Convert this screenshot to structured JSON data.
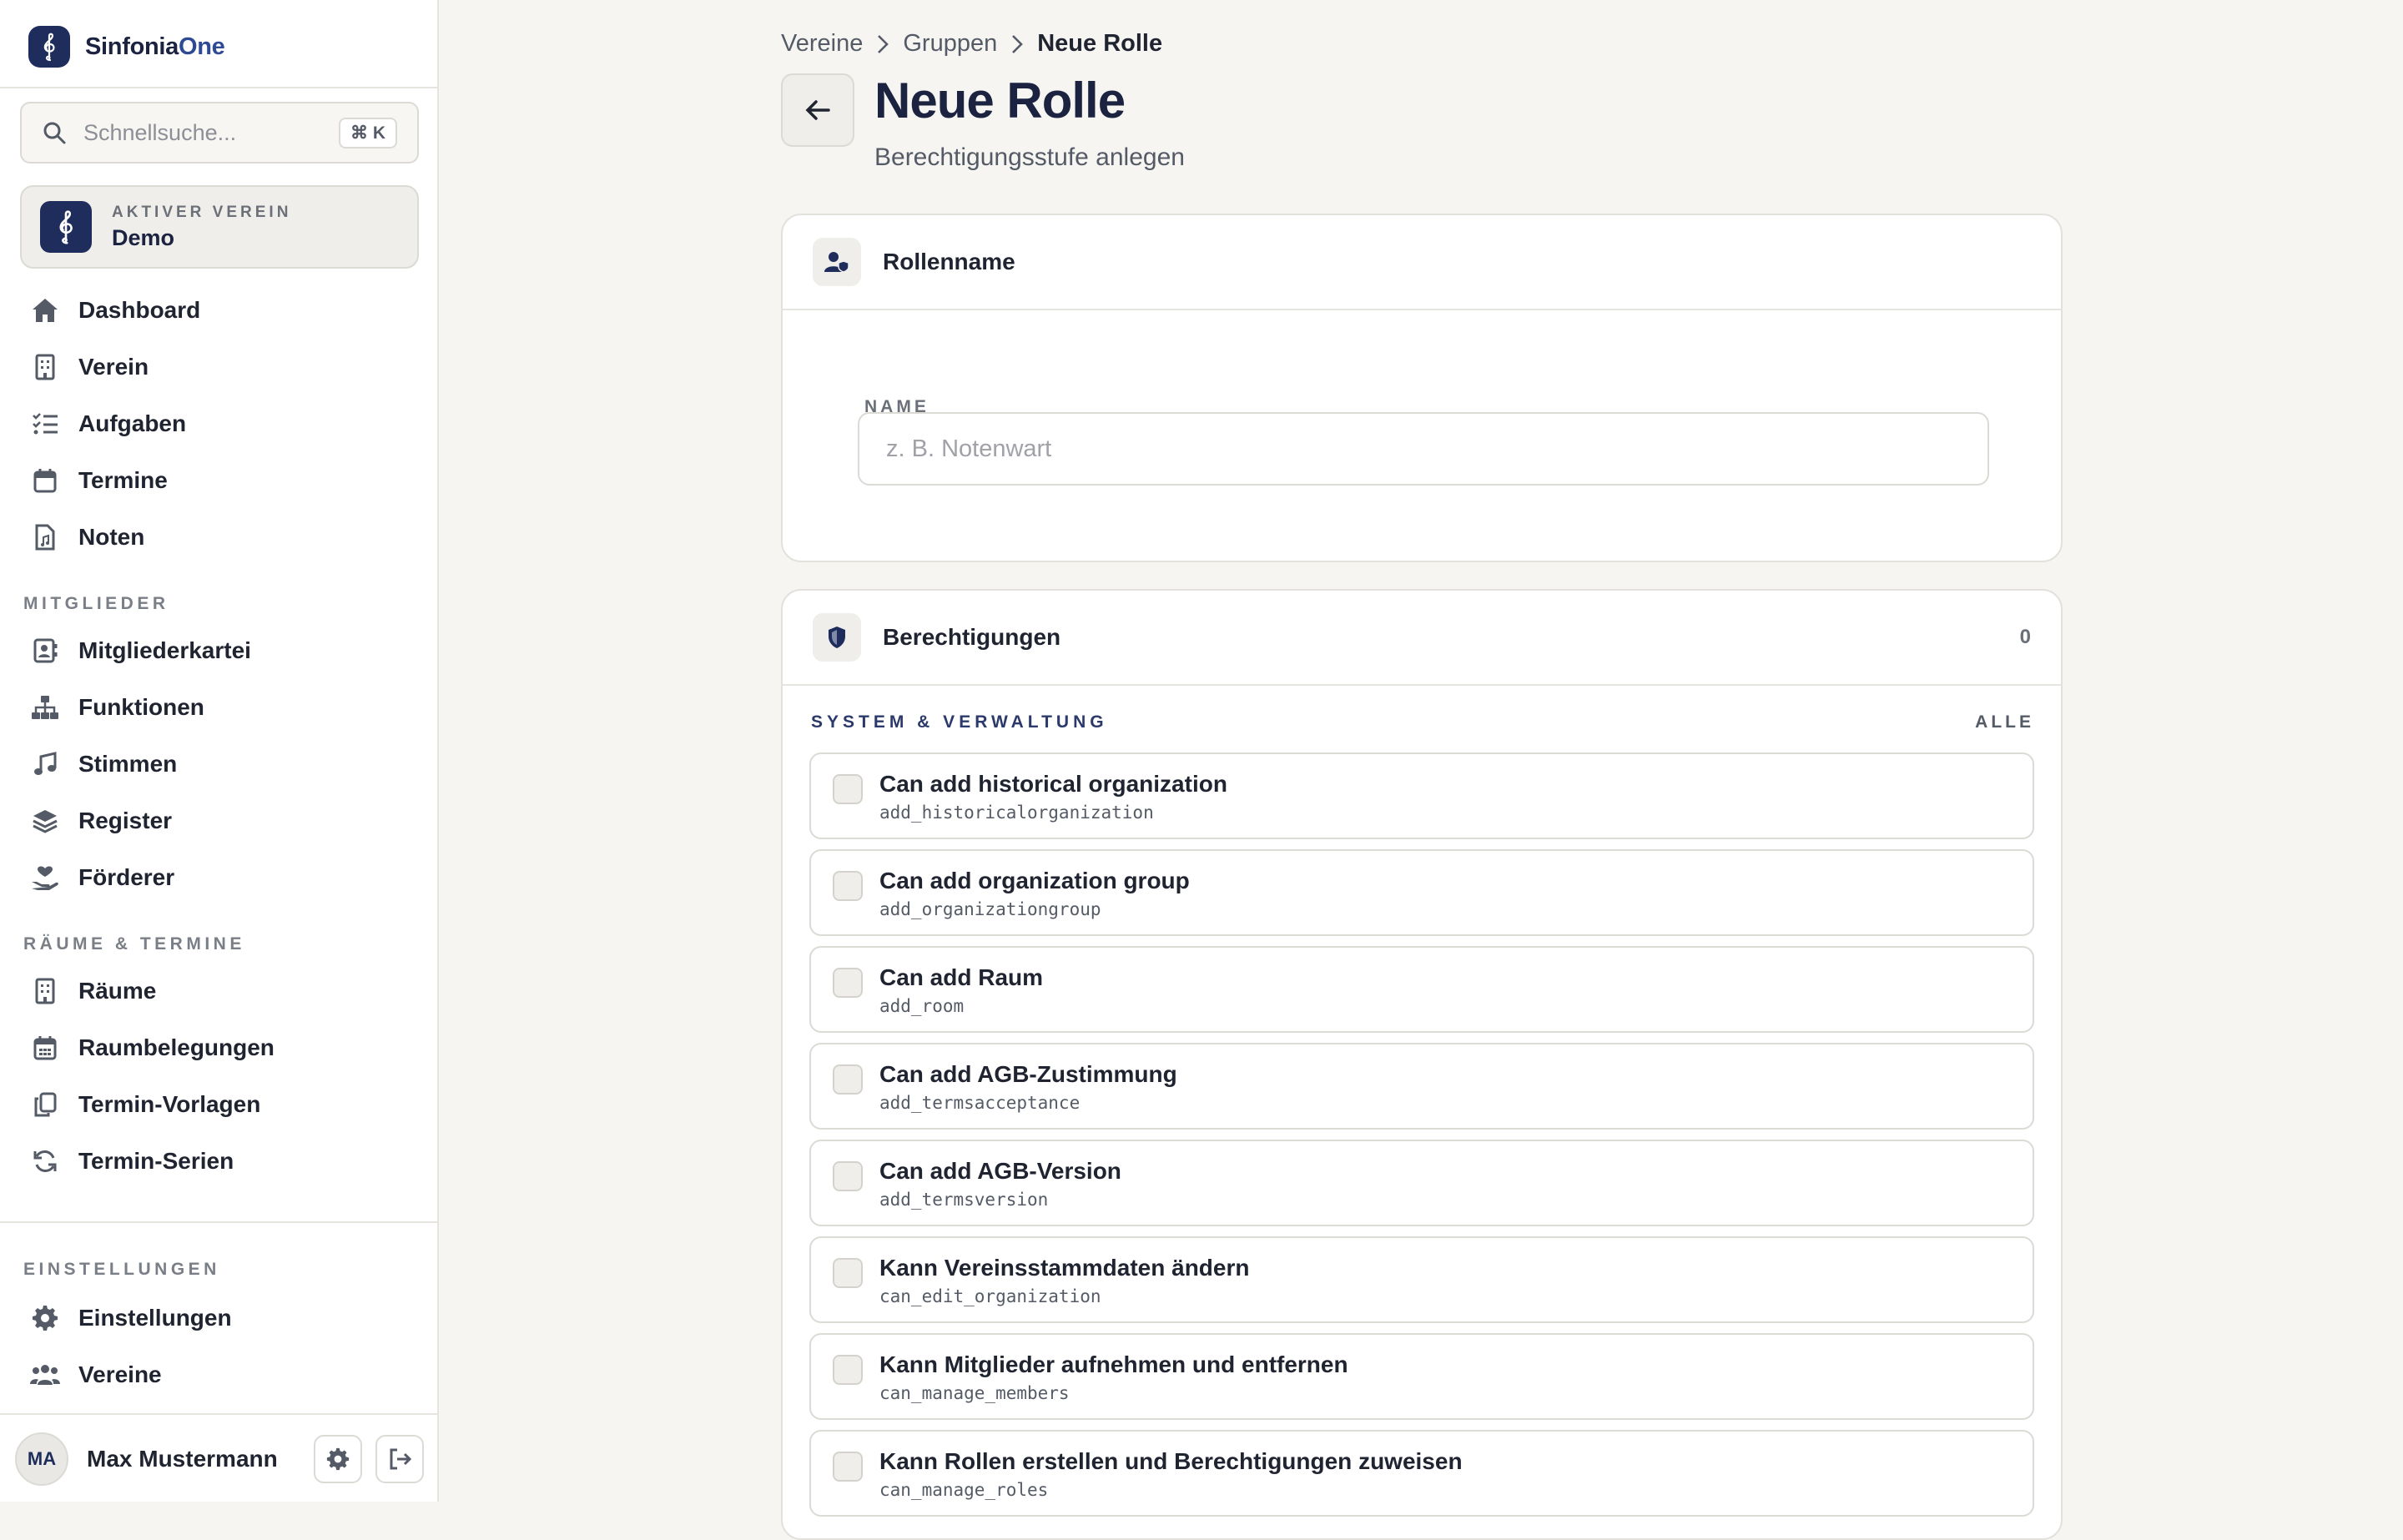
{
  "brand": {
    "name_main": "Sinfonia",
    "name_accent": "One"
  },
  "search": {
    "placeholder": "Schnellsuche...",
    "shortcut": "⌘ K"
  },
  "active_org": {
    "label": "AKTIVER VEREIN",
    "name": "Demo"
  },
  "nav": {
    "main": [
      {
        "label": "Dashboard",
        "icon": "home-icon"
      },
      {
        "label": "Verein",
        "icon": "building-icon"
      },
      {
        "label": "Aufgaben",
        "icon": "list-check-icon"
      },
      {
        "label": "Termine",
        "icon": "calendar-icon"
      },
      {
        "label": "Noten",
        "icon": "file-music-icon"
      }
    ],
    "members_label": "MITGLIEDER",
    "members": [
      {
        "label": "Mitgliederkartei",
        "icon": "contact-card-icon"
      },
      {
        "label": "Funktionen",
        "icon": "sitemap-icon"
      },
      {
        "label": "Stimmen",
        "icon": "music-note-icon"
      },
      {
        "label": "Register",
        "icon": "layers-icon"
      },
      {
        "label": "Förderer",
        "icon": "hand-heart-icon"
      }
    ],
    "rooms_label": "RÄUME & TERMINE",
    "rooms": [
      {
        "label": "Räume",
        "icon": "building-icon"
      },
      {
        "label": "Raumbelegungen",
        "icon": "calendar-grid-icon"
      },
      {
        "label": "Termin-Vorlagen",
        "icon": "copy-icon"
      },
      {
        "label": "Termin-Serien",
        "icon": "refresh-icon"
      }
    ],
    "settings_label": "EINSTELLUNGEN",
    "settings": [
      {
        "label": "Einstellungen",
        "icon": "gear-icon"
      },
      {
        "label": "Vereine",
        "icon": "users-icon"
      }
    ]
  },
  "user": {
    "initials": "MA",
    "name": "Max Mustermann"
  },
  "breadcrumb": [
    "Vereine",
    "Gruppen",
    "Neue Rolle"
  ],
  "page": {
    "title": "Neue Rolle",
    "subtitle": "Berechtigungsstufe anlegen"
  },
  "role_card": {
    "title": "Rollenname",
    "field_label": "NAME",
    "placeholder": "z. B. Notenwart",
    "value": ""
  },
  "perm_card": {
    "title": "Berechtigungen",
    "count": "0",
    "group_title": "SYSTEM & VERWALTUNG",
    "select_all": "ALLE",
    "items": [
      {
        "title": "Can add historical organization",
        "code": "add_historicalorganization",
        "checked": false
      },
      {
        "title": "Can add organization group",
        "code": "add_organizationgroup",
        "checked": false
      },
      {
        "title": "Can add Raum",
        "code": "add_room",
        "checked": false
      },
      {
        "title": "Can add AGB-Zustimmung",
        "code": "add_termsacceptance",
        "checked": false
      },
      {
        "title": "Can add AGB-Version",
        "code": "add_termsversion",
        "checked": false
      },
      {
        "title": "Kann Vereinsstammdaten ändern",
        "code": "can_edit_organization",
        "checked": false
      },
      {
        "title": "Kann Mitglieder aufnehmen und entfernen",
        "code": "can_manage_members",
        "checked": false
      },
      {
        "title": "Kann Rollen erstellen und Berechtigungen zuweisen",
        "code": "can_manage_roles",
        "checked": false
      }
    ]
  },
  "colors": {
    "brand_navy": "#1f2d5c",
    "accent_blue": "#2e4a94",
    "background": "#f6f5f2"
  }
}
